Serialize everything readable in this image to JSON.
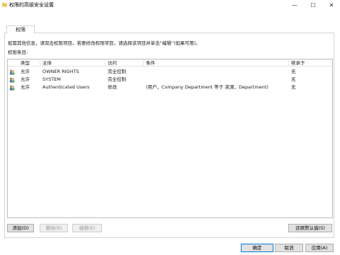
{
  "window": {
    "title": "权限的高级安全设置",
    "minimize_glyph": "—",
    "maximize_glyph": "☐",
    "close_glyph": "✕"
  },
  "tab": {
    "label": "权限"
  },
  "hint": "如需其他信息，请双击权限项目。若要修改权限项目，请选择该项目并单击“编辑”(如果可用)。",
  "entries_label": "权限条目:",
  "table": {
    "columns": [
      "类型",
      "主体",
      "访问",
      "条件",
      "继承于"
    ],
    "rows": [
      {
        "type": "允许",
        "principal": "OWNER RIGHTS",
        "access": "完全控制",
        "condition": "",
        "inherited": "无"
      },
      {
        "type": "允许",
        "principal": "SYSTEM",
        "access": "完全控制",
        "condition": "",
        "inherited": "无"
      },
      {
        "type": "允许",
        "principal": "Authenticated Users",
        "access": "修改",
        "condition": "(用户，Company Department 等于 资源，Department)",
        "inherited": "无"
      }
    ]
  },
  "buttons": {
    "add": "添加(D)",
    "remove": "删除(R)",
    "edit": "编辑(E)",
    "restore": "还原默认值(S)",
    "ok": "确定",
    "cancel": "取消",
    "apply": "应用(A)"
  },
  "colors": {
    "accent": "#0078d7",
    "folder_icon": "#e8b23b"
  }
}
